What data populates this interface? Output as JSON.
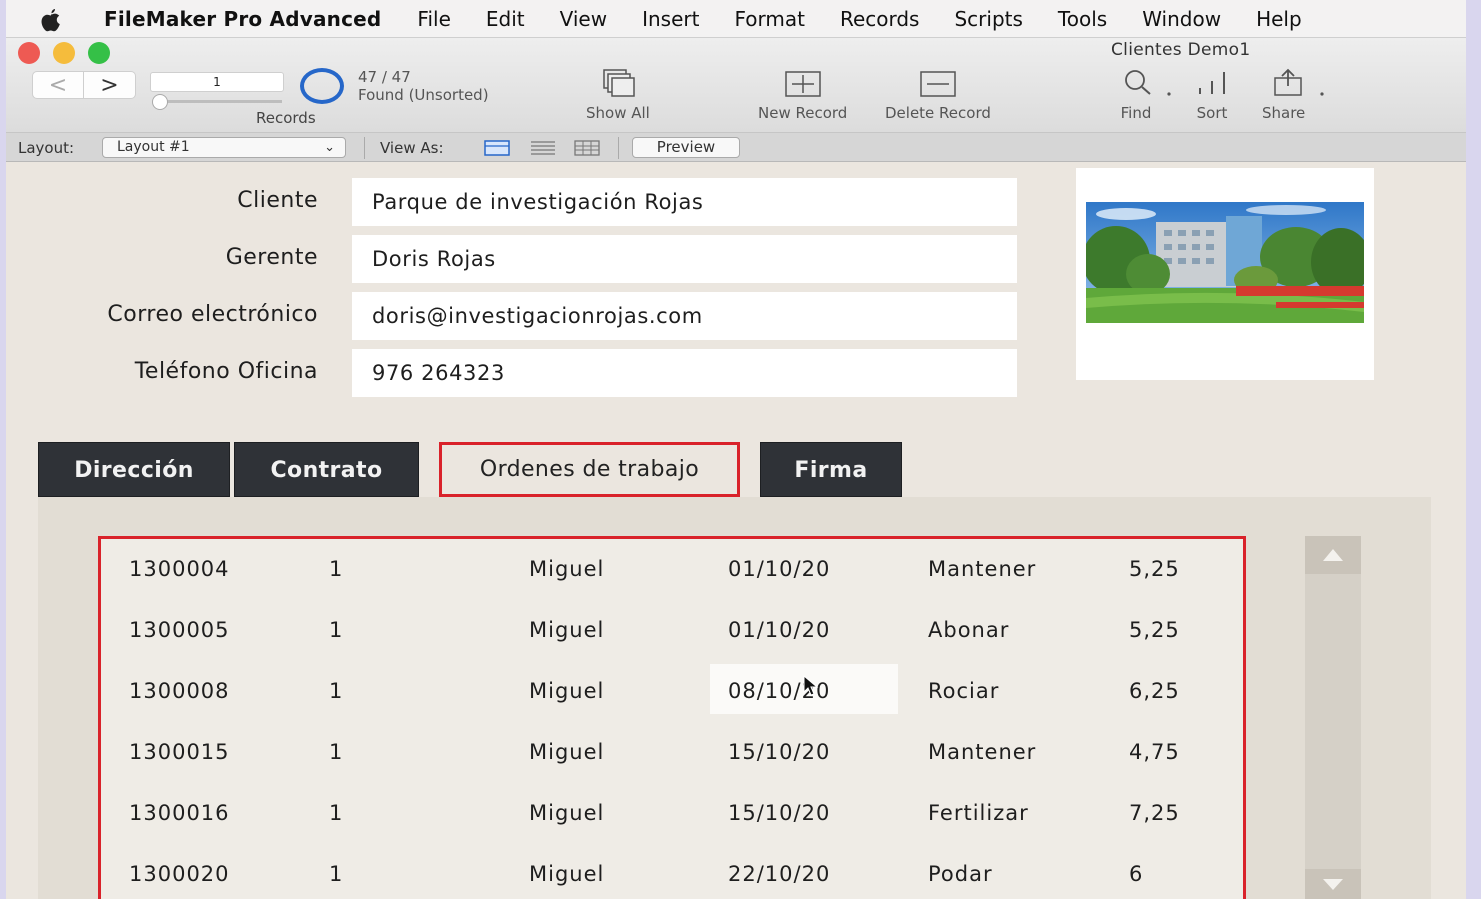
{
  "menubar": {
    "app_name": "FileMaker Pro Advanced",
    "items": [
      "File",
      "Edit",
      "View",
      "Insert",
      "Format",
      "Records",
      "Scripts",
      "Tools",
      "Window",
      "Help"
    ]
  },
  "window": {
    "title": "Clientes Demo1"
  },
  "toolbar": {
    "record_number": "1",
    "records_label": "Records",
    "found_count": "47 / 47",
    "found_status": "Found (Unsorted)",
    "show_all": "Show All",
    "new_record": "New Record",
    "delete_record": "Delete Record",
    "find": "Find",
    "sort": "Sort",
    "share": "Share"
  },
  "layoutbar": {
    "layout_label": "Layout:",
    "layout_value": "Layout #1",
    "view_as_label": "View As:",
    "preview": "Preview"
  },
  "fields": {
    "cliente_label": "Cliente",
    "cliente_value": "Parque de investigación Rojas",
    "gerente_label": "Gerente",
    "gerente_value": "Doris Rojas",
    "correo_label": "Correo electrónico",
    "correo_value": "doris@investigacionrojas.com",
    "telefono_label": "Teléfono Oficina",
    "telefono_value": "976 264323"
  },
  "tabs": [
    {
      "label": "Dirección"
    },
    {
      "label": "Contrato"
    },
    {
      "label": "Ordenes de trabajo"
    },
    {
      "label": "Firma"
    }
  ],
  "active_tab": "Ordenes de trabajo",
  "portal": {
    "rows": [
      {
        "order": "1300004",
        "qty": "1",
        "worker": "Miguel",
        "date": "01/10/20",
        "task": "Mantener",
        "amount": "5,25"
      },
      {
        "order": "1300005",
        "qty": "1",
        "worker": "Miguel",
        "date": "01/10/20",
        "task": "Abonar",
        "amount": "5,25"
      },
      {
        "order": "1300008",
        "qty": "1",
        "worker": "Miguel",
        "date": "08/10/20",
        "task": "Rociar",
        "amount": "6,25"
      },
      {
        "order": "1300015",
        "qty": "1",
        "worker": "Miguel",
        "date": "15/10/20",
        "task": "Mantener",
        "amount": "4,75"
      },
      {
        "order": "1300016",
        "qty": "1",
        "worker": "Miguel",
        "date": "15/10/20",
        "task": "Fertilizar",
        "amount": "7,25"
      },
      {
        "order": "1300020",
        "qty": "1",
        "worker": "Miguel",
        "date": "22/10/20",
        "task": "Podar",
        "amount": "6"
      }
    ]
  },
  "colors": {
    "highlight_red": "#d9222a",
    "tab_dark": "#2f3237",
    "found_ring": "#2667c9"
  }
}
